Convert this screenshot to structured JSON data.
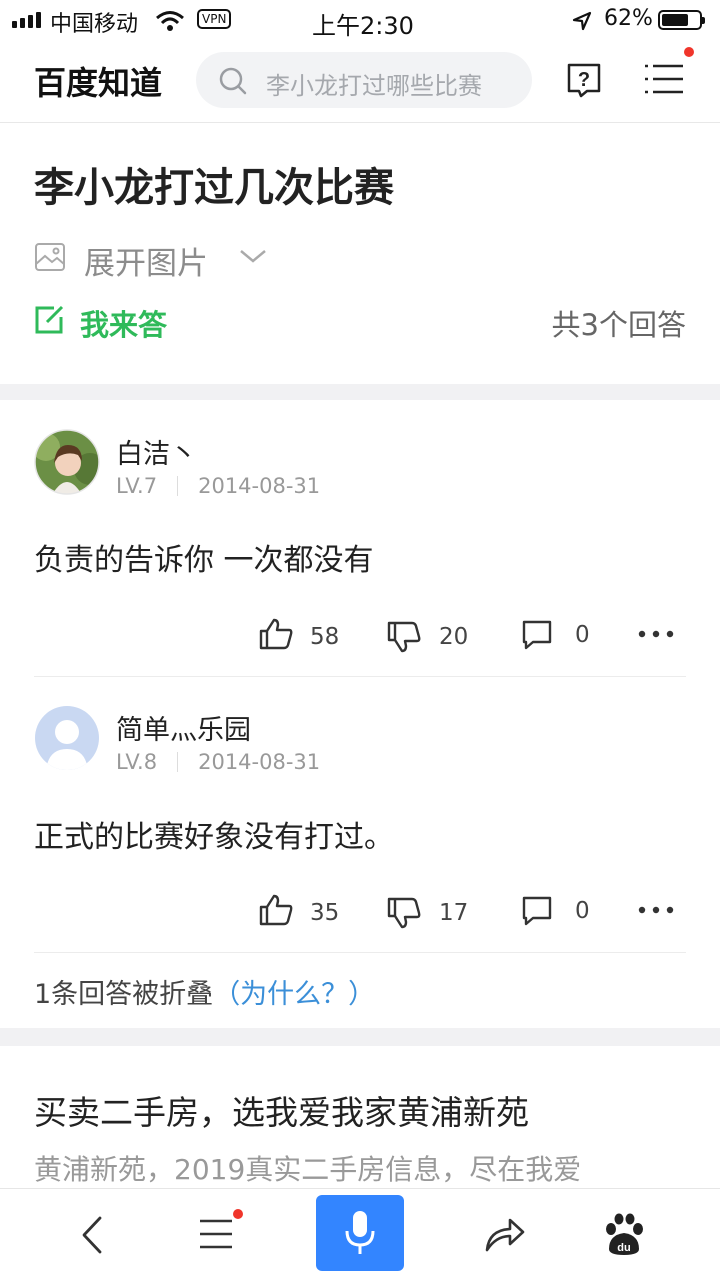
{
  "status": {
    "carrier": "中国移动",
    "vpn": "VPN",
    "time": "上午2:30",
    "battery": "62%"
  },
  "header": {
    "brand": "百度知道",
    "search_placeholder": "李小龙打过哪些比赛"
  },
  "question": {
    "title": "李小龙打过几次比赛",
    "expand_images": "展开图片",
    "answer_button": "我来答",
    "answer_count": "共3个回答"
  },
  "answers": [
    {
      "name": "白洁丶",
      "level": "LV.7",
      "date": "2014-08-31",
      "body": "负责的告诉你 一次都没有",
      "likes": "58",
      "dislikes": "20",
      "comments": "0"
    },
    {
      "name": "简单灬乐园",
      "level": "LV.8",
      "date": "2014-08-31",
      "body": "正式的比赛好象没有打过。",
      "likes": "35",
      "dislikes": "17",
      "comments": "0"
    }
  ],
  "folded": {
    "text": "1条回答被折叠",
    "link": "（为什么？）"
  },
  "ad": {
    "title": "买卖二手房，选我爱我家黄浦新苑",
    "subtitle": "黄浦新苑，2019真实二手房信息，尽在我爱"
  },
  "icons": [
    "signal-icon",
    "wifi-icon",
    "location-icon",
    "battery-icon",
    "search-icon",
    "help-icon",
    "menu-icon",
    "image-icon",
    "chevron-down-icon",
    "edit-icon",
    "thumb-up-icon",
    "thumb-down-icon",
    "comment-icon",
    "more-icon",
    "back-icon",
    "microphone-icon",
    "share-icon",
    "baidu-paw-icon"
  ],
  "colors": {
    "accent_green": "#2fba5a",
    "link_blue": "#3b8fd8",
    "mic_blue": "#3385ff",
    "notify_red": "#f0352b"
  }
}
